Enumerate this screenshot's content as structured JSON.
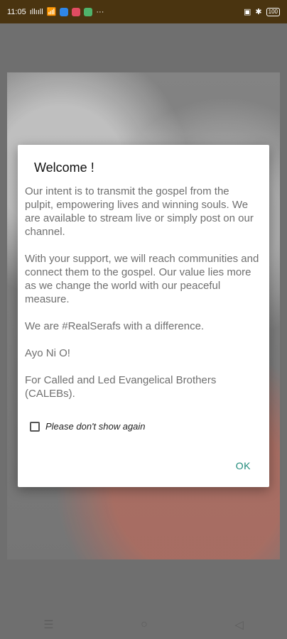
{
  "status_bar": {
    "time": "11:05",
    "signal_text": "ıllııll",
    "wifi_icon": "wifi-icon",
    "apps": [
      {
        "name": "app-icon-blue",
        "color": "#2f86e8"
      },
      {
        "name": "app-icon-red",
        "color": "#e04c62"
      },
      {
        "name": "app-icon-green",
        "color": "#4fb36b"
      }
    ],
    "more": "···",
    "battery": "100"
  },
  "dialog": {
    "title": "Welcome !",
    "paragraphs": [
      "Our intent is to transmit the gospel from the pulpit, empowering lives and winning souls. We are available to stream live or simply post on our channel.",
      "With your support, we will reach communities and connect them to the gospel. Our value lies more as we change the world with our peaceful measure.",
      "We are #RealSerafs with a difference.",
      "Ayo Ni O!",
      "For Called and Led Evangelical Brothers (CALEBs)."
    ],
    "checkbox_label": "Please don't show again",
    "ok_label": "OK"
  },
  "nav_bar": {
    "menu": "☰",
    "home": "○",
    "back": "◁"
  },
  "colors": {
    "status_bar": "#4a3410",
    "accent": "#1f8a7a",
    "body_text": "#6f6f6f"
  }
}
